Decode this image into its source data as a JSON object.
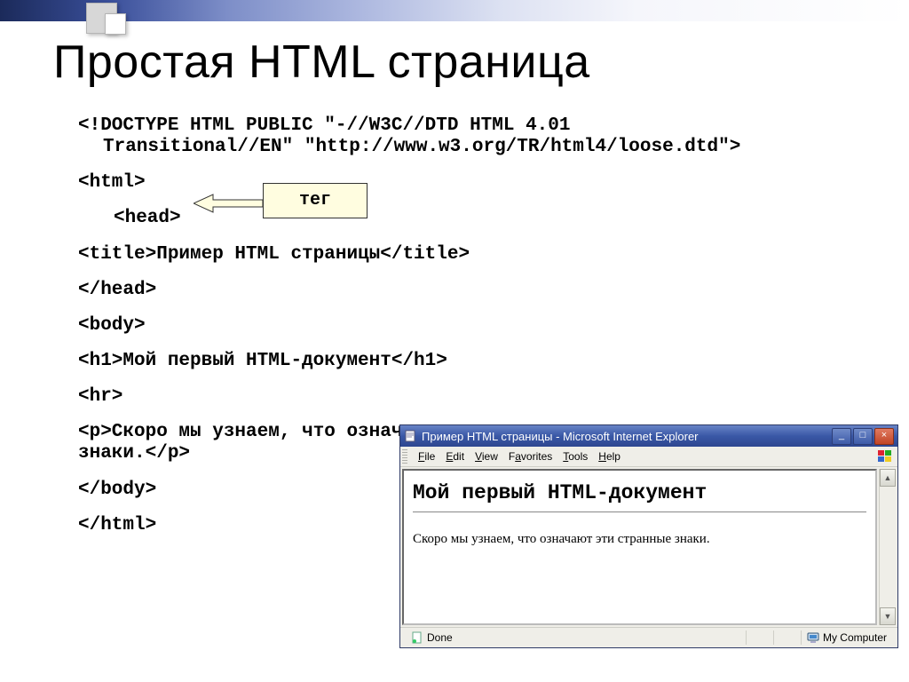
{
  "slide": {
    "title": "Простая HTML страница"
  },
  "callout": {
    "label": "тег"
  },
  "code": {
    "doctype_l1": "<!DOCTYPE HTML PUBLIC \"-//W3C//DTD HTML 4.01",
    "doctype_l2": "Transitional//EN\" \"http://www.w3.org/TR/html4/loose.dtd\">",
    "html_open": "<html>",
    "head_open": "<head>",
    "title_line": "<title>Пример HTML страницы</title>",
    "head_close": "</head>",
    "body_open": "<body>",
    "h1_line": "<h1>Мой первый HTML-документ</h1>",
    "hr_line": "<hr>",
    "p_l1": "<p>Скоро мы узнаем, что означают эти странные",
    "p_l2": "знаки.</p>",
    "body_close": "</body>",
    "html_close": "</html>"
  },
  "ie": {
    "title": "Пример HTML страницы - Microsoft Internet Explorer",
    "menu": {
      "file": "File",
      "edit": "Edit",
      "view": "View",
      "favorites": "Favorites",
      "tools": "Tools",
      "help": "Help"
    },
    "content": {
      "heading": "Мой первый HTML-документ",
      "paragraph": "Скоро мы узнаем, что означают эти странные знаки."
    },
    "status": {
      "done": "Done",
      "zone": "My Computer"
    }
  }
}
